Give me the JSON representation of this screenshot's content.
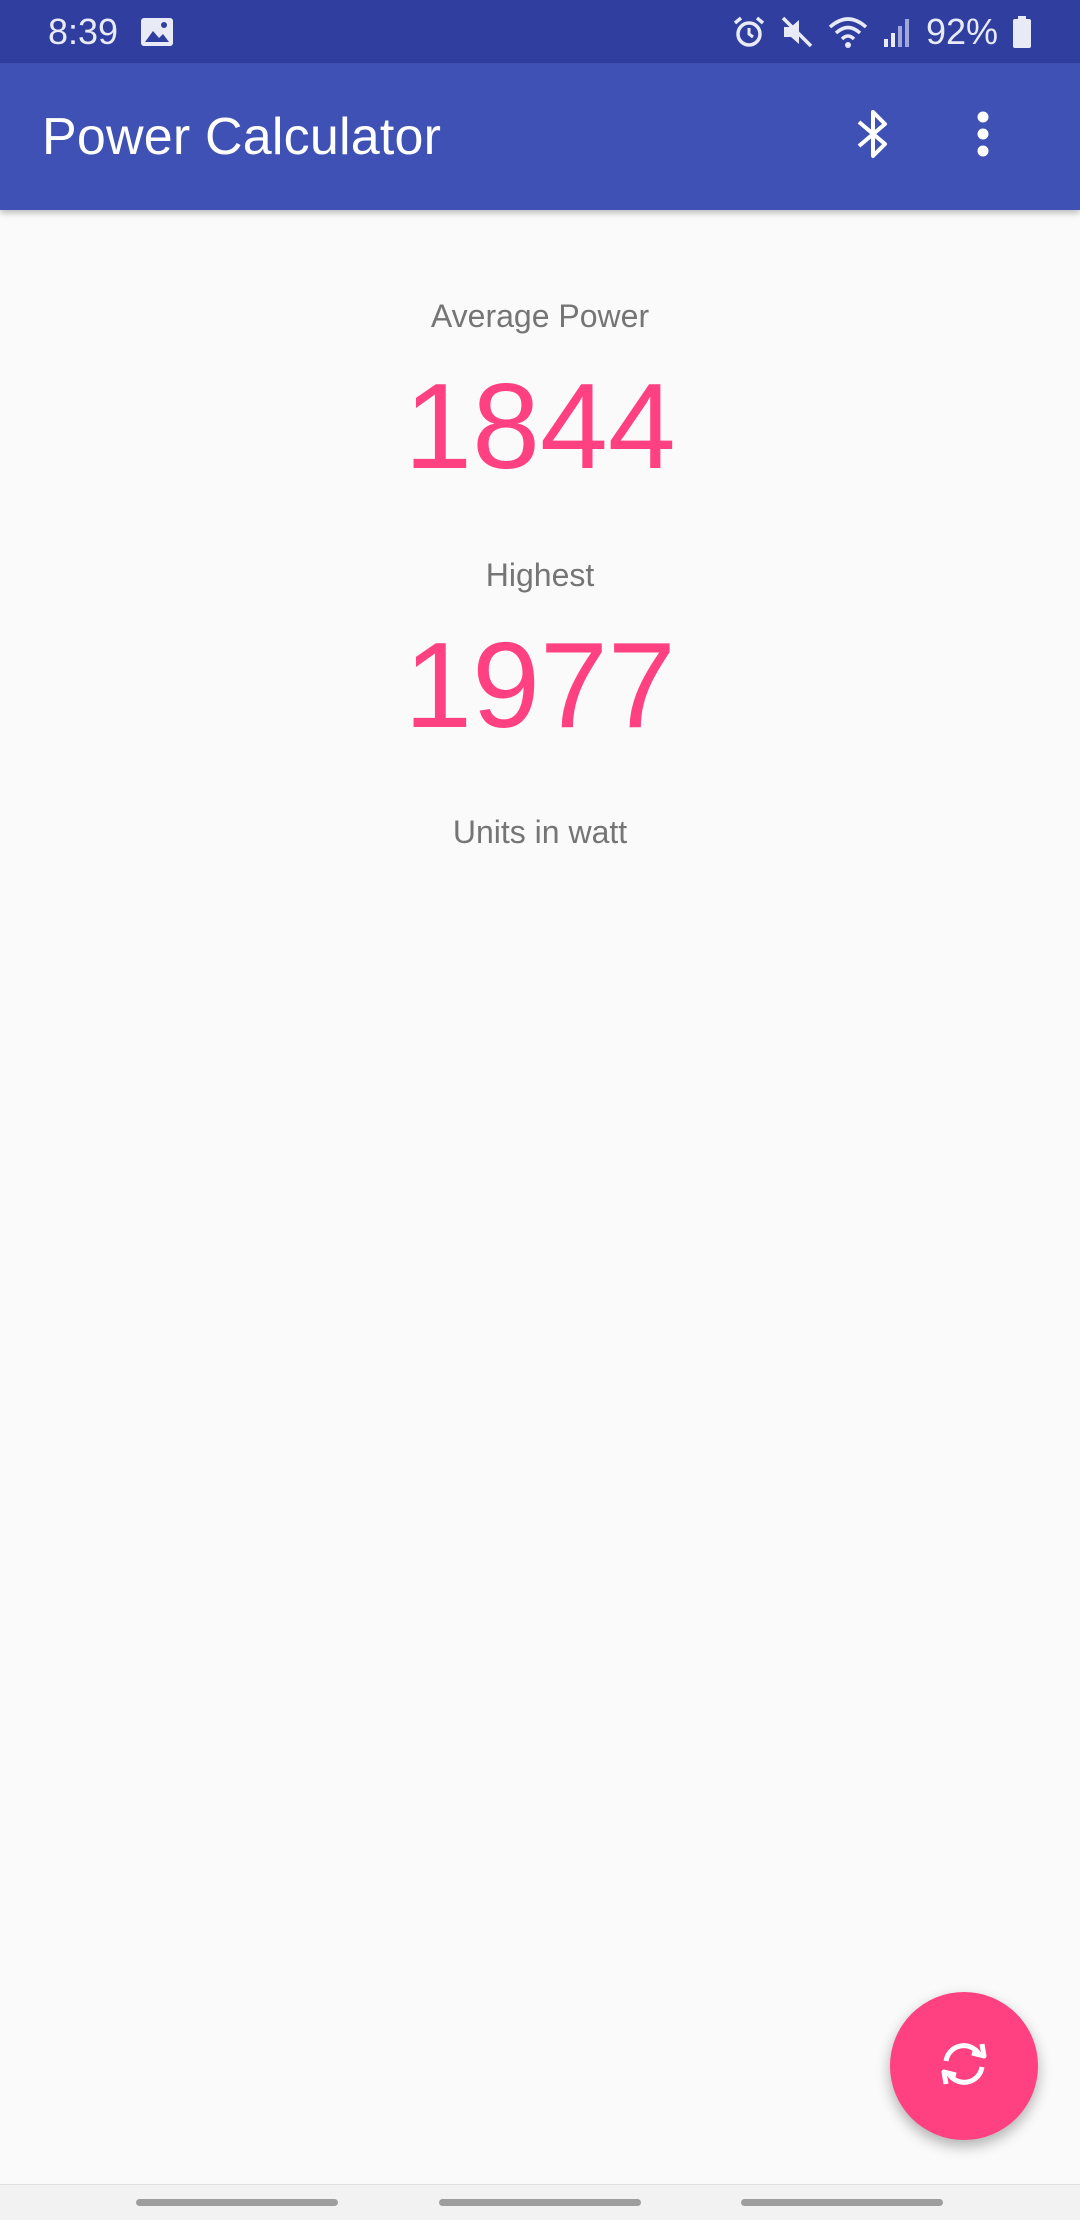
{
  "status_bar": {
    "time": "8:39",
    "battery": "92%",
    "icons": [
      "image-icon",
      "alarm-icon",
      "mute-icon",
      "wifi-icon",
      "signal-icon",
      "battery-icon"
    ]
  },
  "app_bar": {
    "title": "Power Calculator",
    "actions": [
      "bluetooth-icon",
      "more-vert-icon"
    ]
  },
  "main": {
    "average_label": "Average Power",
    "average_value": "1844",
    "highest_label": "Highest",
    "highest_value": "1977",
    "units_text": "Units in watt"
  },
  "fab": {
    "icon": "refresh-icon"
  },
  "colors": {
    "status_bar": "#303f9f",
    "app_bar": "#3f51b5",
    "accent": "#ff4081",
    "background": "#fafafa"
  }
}
